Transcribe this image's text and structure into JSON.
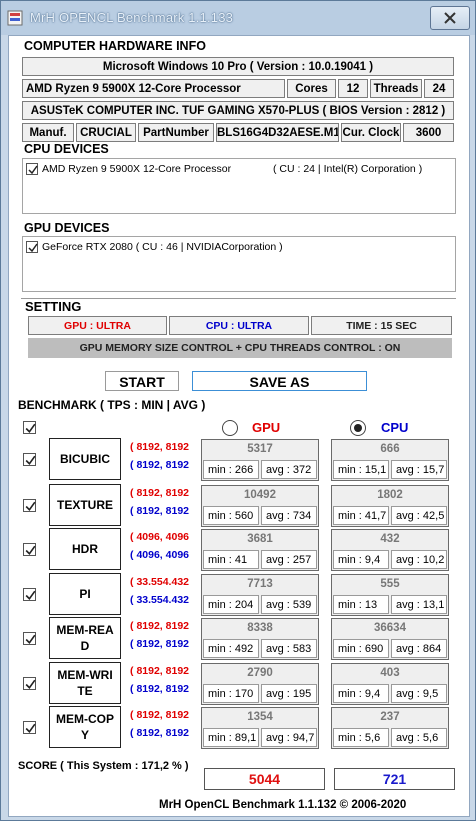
{
  "window": {
    "title": "MrH OPENCL Benchmark 1.1.133"
  },
  "hardware": {
    "heading": "COMPUTER HARDWARE INFO",
    "os": "Microsoft Windows 10 Pro ( Version : 10.0.19041 )",
    "cpu_name": "AMD Ryzen 9 5900X 12-Core Processor",
    "cores_label": "Cores",
    "cores_value": "12",
    "threads_label": "Threads",
    "threads_value": "24",
    "board": "ASUSTeK COMPUTER INC. TUF GAMING X570-PLUS ( BIOS Version : 2812 )",
    "manuf_label": "Manuf.",
    "manuf_value": "CRUCIAL",
    "part_label": "PartNumber",
    "part_value": "BLS16G4D32AESE.M1",
    "clock_label": "Cur. Clock",
    "clock_value": "3600"
  },
  "cpu_devices": {
    "heading": "CPU DEVICES",
    "items": [
      {
        "name": "AMD Ryzen 9 5900X 12-Core Processor",
        "info": "( CU : 24 | Intel(R) Corporation )",
        "checked": true
      }
    ]
  },
  "gpu_devices": {
    "heading": "GPU DEVICES",
    "items": [
      {
        "name": "GeForce RTX 2080 ( CU : 46 | NVIDIACorporation )",
        "checked": true
      }
    ]
  },
  "setting": {
    "heading": "SETTING",
    "gpu_mode": "GPU : ULTRA",
    "cpu_mode": "CPU : ULTRA",
    "time": "TIME : 15 SEC",
    "control": "GPU MEMORY SIZE CONTROL + CPU THREADS CONTROL : ON"
  },
  "buttons": {
    "start": "START",
    "save": "SAVE AS"
  },
  "benchmark": {
    "heading": "BENCHMARK ( TPS : MIN | AVG )",
    "gpu_label": "GPU",
    "cpu_label": "CPU",
    "rows": [
      {
        "name": "BICUBIC",
        "gpu_dim": "( 8192, 8192",
        "cpu_dim": "( 8192, 8192",
        "gpu": {
          "value": "5317",
          "min": "min : 266",
          "avg": "avg : 372"
        },
        "cpu": {
          "value": "666",
          "min": "min : 15,1",
          "avg": "avg : 15,7"
        }
      },
      {
        "name": "TEXTURE",
        "gpu_dim": "( 8192, 8192",
        "cpu_dim": "( 8192, 8192",
        "gpu": {
          "value": "10492",
          "min": "min : 560",
          "avg": "avg : 734"
        },
        "cpu": {
          "value": "1802",
          "min": "min : 41,7",
          "avg": "avg : 42,5"
        }
      },
      {
        "name": "HDR",
        "gpu_dim": "( 4096, 4096",
        "cpu_dim": "( 4096, 4096",
        "gpu": {
          "value": "3681",
          "min": "min : 41",
          "avg": "avg : 257"
        },
        "cpu": {
          "value": "432",
          "min": "min : 9,4",
          "avg": "avg : 10,2"
        }
      },
      {
        "name": "PI",
        "gpu_dim": "( 33.554.432",
        "cpu_dim": "( 33.554.432",
        "gpu": {
          "value": "7713",
          "min": "min : 204",
          "avg": "avg : 539"
        },
        "cpu": {
          "value": "555",
          "min": "min : 13",
          "avg": "avg : 13,1"
        }
      },
      {
        "name_l1": "MEM-REA",
        "name_l2": "D",
        "gpu_dim": "( 8192, 8192",
        "cpu_dim": "( 8192, 8192",
        "gpu": {
          "value": "8338",
          "min": "min : 492",
          "avg": "avg : 583"
        },
        "cpu": {
          "value": "36634",
          "min": "min : 690",
          "avg": "avg : 864"
        }
      },
      {
        "name_l1": "MEM-WRI",
        "name_l2": "TE",
        "gpu_dim": "( 8192, 8192",
        "cpu_dim": "( 8192, 8192",
        "gpu": {
          "value": "2790",
          "min": "min : 170",
          "avg": "avg : 195"
        },
        "cpu": {
          "value": "403",
          "min": "min : 9,4",
          "avg": "avg : 9,5"
        }
      },
      {
        "name_l1": "MEM-COP",
        "name_l2": "Y",
        "gpu_dim": "( 8192, 8192",
        "cpu_dim": "( 8192, 8192",
        "gpu": {
          "value": "1354",
          "min": "min : 89,1",
          "avg": "avg : 94,7"
        },
        "cpu": {
          "value": "237",
          "min": "min : 5,6",
          "avg": "avg : 5,6"
        }
      }
    ]
  },
  "score": {
    "label": "SCORE ( This System : 171,2 % )",
    "gpu": "5044",
    "cpu": "721"
  },
  "footer": "MrH OpenCL Benchmark 1.1.132  ©  2006-2020",
  "colors": {
    "gpu": "#e00000",
    "cpu": "#0000cc",
    "score_gpu": "#e01010",
    "score_cpu": "#1a1acc"
  }
}
